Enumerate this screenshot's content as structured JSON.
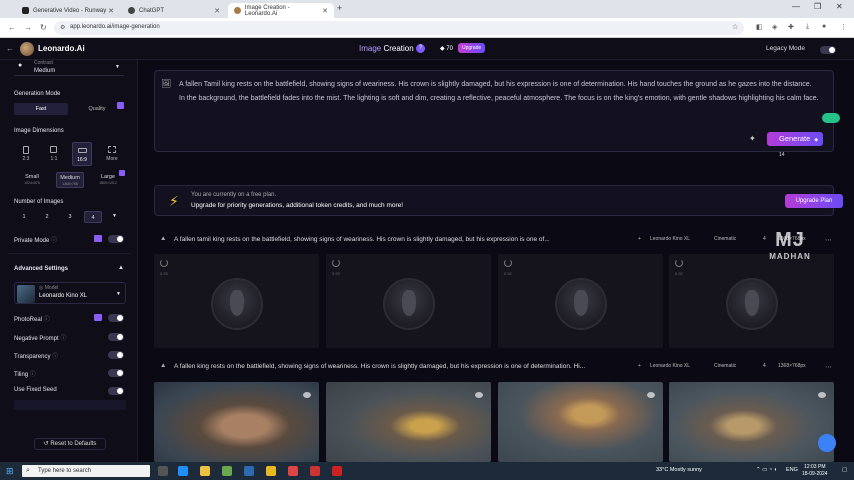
{
  "browser": {
    "tabs": [
      {
        "title": "Generative Video - Runway",
        "active": false
      },
      {
        "title": "ChatGPT",
        "active": false
      },
      {
        "title": "Image Creation - Leonardo.Ai",
        "active": true
      }
    ],
    "url": "app.leonardo.ai/image-generation"
  },
  "header": {
    "logo_text": "Leonardo.Ai",
    "mode_title_hl": "Image",
    "mode_title": "Creation",
    "tokens": "70",
    "upgrade_label": "Upgrade",
    "legacy_label": "Legacy Mode"
  },
  "sidebar": {
    "contrast_label": "Contrast",
    "contrast_value": "Medium",
    "gen_mode_label": "Generation Mode",
    "gen_modes": [
      "Fast",
      "Quality"
    ],
    "dims_label": "Image Dimensions",
    "dims": [
      "2:3",
      "1:1",
      "16:9",
      "More"
    ],
    "sizes": [
      {
        "label": "Small",
        "sub": "1024×576"
      },
      {
        "label": "Medium",
        "sub": "1368×768"
      },
      {
        "label": "Large",
        "sub": "1800×1012"
      }
    ],
    "num_images_label": "Number of Images",
    "num_images": [
      "1",
      "2",
      "3",
      "4"
    ],
    "private_mode_label": "Private Mode",
    "advanced_label": "Advanced Settings",
    "model_caption": "Model",
    "model_name": "Leonardo Kino XL",
    "photoreal_label": "PhotoReal",
    "negative_prompt_label": "Negative Prompt",
    "transparency_label": "Transparency",
    "tiling_label": "Tiling",
    "fixed_seed_label": "Use Fixed Seed",
    "reset_label": "Reset to Defaults"
  },
  "main": {
    "prompt": "A fallen Tamil king rests on the battlefield, showing signs of weariness. His crown is slightly damaged, but his expression is one of determination. His hand touches the ground as he gazes into the distance. In the background, the battlefield fades into the mist. The lighting is soft and dim, creating a reflective, peaceful atmosphere. The focus is on the king's emotion, with gentle shadows highlighting his calm face.",
    "generate_label": "Generate",
    "generate_cost": "14",
    "free_line1": "You are currently on a free plan.",
    "free_line2": "Upgrade for priority generations, additional token credits, and much more!",
    "upgrade_plan_label": "Upgrade Plan",
    "generations": [
      {
        "prompt": "A fallen tamil king rests on the battlefield, showing signs of weariness. His crown is slightly damaged, but his expression is one of...",
        "model": "Leonardo Kino XL",
        "style": "Cinematic",
        "count": "4",
        "size": "1368×768px",
        "timers": [
          "0.93",
          "0.93",
          "0.92",
          "0.92"
        ]
      },
      {
        "prompt": "A fallen king rests on the battlefield, showing signs of weariness. His crown is slightly damaged, but his expression is one of determination. Hi...",
        "model": "Leonardo Kino XL",
        "style": "Cinematic",
        "count": "4",
        "size": "1368×768px"
      }
    ]
  },
  "watermark": {
    "big": "MJ",
    "small": "MADHAN"
  },
  "taskbar": {
    "search_placeholder": "Type here to search",
    "weather": "33°C  Mostly sunny",
    "lang": "ENG",
    "time": "12:03 PM",
    "date": "18-09-2024"
  }
}
